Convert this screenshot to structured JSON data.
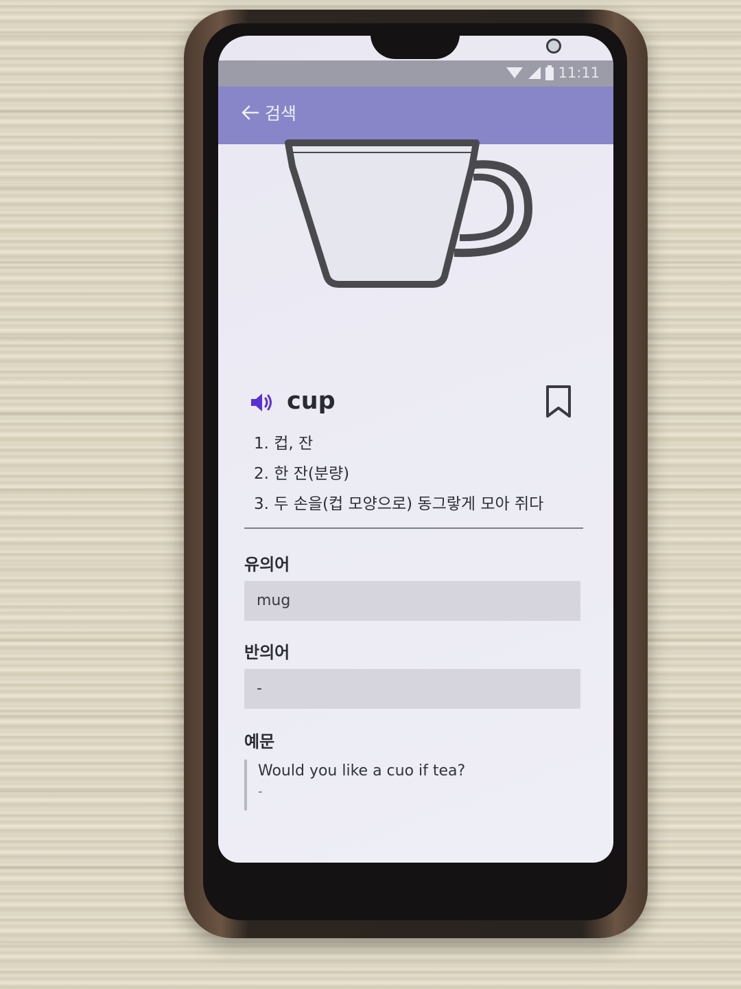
{
  "status_bar": {
    "time": "11:11"
  },
  "app_bar": {
    "title": "검색"
  },
  "entry": {
    "word": "cup",
    "meanings": [
      "1. 컵, 잔",
      "2. 한 잔(분량)",
      "3. 두 손을(컵 모양으로) 동그랗게 모아 쥐다"
    ]
  },
  "synonyms": {
    "label": "유의어",
    "value": "mug"
  },
  "antonyms": {
    "label": "반의어",
    "value": "-"
  },
  "examples": {
    "label": "예문",
    "sentence": "Would you like a cuo if tea?",
    "translation": "-"
  },
  "colors": {
    "app_bar": "#8886c8",
    "accent": "#5b2fd6",
    "background": "#ecebf4"
  },
  "icons": [
    "back-arrow-icon",
    "wifi-icon",
    "signal-icon",
    "battery-icon",
    "cup-image",
    "speaker-icon",
    "bookmark-icon"
  ]
}
